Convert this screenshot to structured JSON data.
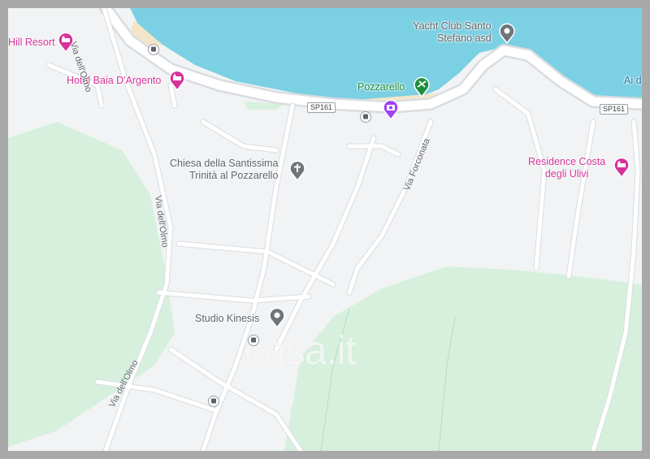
{
  "colors": {
    "water": "#7bd0e3",
    "park": "#d6f0dd",
    "land": "#f1f3f4",
    "road": "#ffffff",
    "road_edge": "#d9dde1",
    "lodging": "#d6339a",
    "poi_gray": "#70757a",
    "park_poi": "#1e8e3e"
  },
  "places": {
    "hill_resort": {
      "name": "Hill Resort",
      "icon": "hotel-icon"
    },
    "hotel_baia": {
      "name": "Hotel Baia D'Argento",
      "icon": "hotel-icon"
    },
    "yacht_club": {
      "name_line1": "Yacht Club Santo",
      "name_line2": "Stefano asd",
      "icon": "place-icon"
    },
    "ai_d": {
      "name": "Ai d"
    },
    "pozzarello": {
      "name": "Pozzarello",
      "icon": "beach-icon"
    },
    "chiesa": {
      "name_line1": "Chiesa della Santissima",
      "name_line2": "Trinità al Pozzarello",
      "icon": "church-icon"
    },
    "residence": {
      "name_line1": "Residence Costa",
      "name_line2": "degli Ulivi",
      "icon": "hotel-icon"
    },
    "studio": {
      "name": "Studio Kinesis",
      "icon": "place-icon"
    },
    "camera_poi": {
      "icon": "camera-icon"
    }
  },
  "roads": {
    "via_olmo_top": "Via dell'Olmo",
    "via_olmo_mid": "Via dell'Olmo",
    "via_olmo_bottom": "Via dell'Olmo",
    "via_forconata": "Via Forconata",
    "sp161_a": "SP161",
    "sp161_b": "SP161"
  },
  "watermark": "casa.it"
}
